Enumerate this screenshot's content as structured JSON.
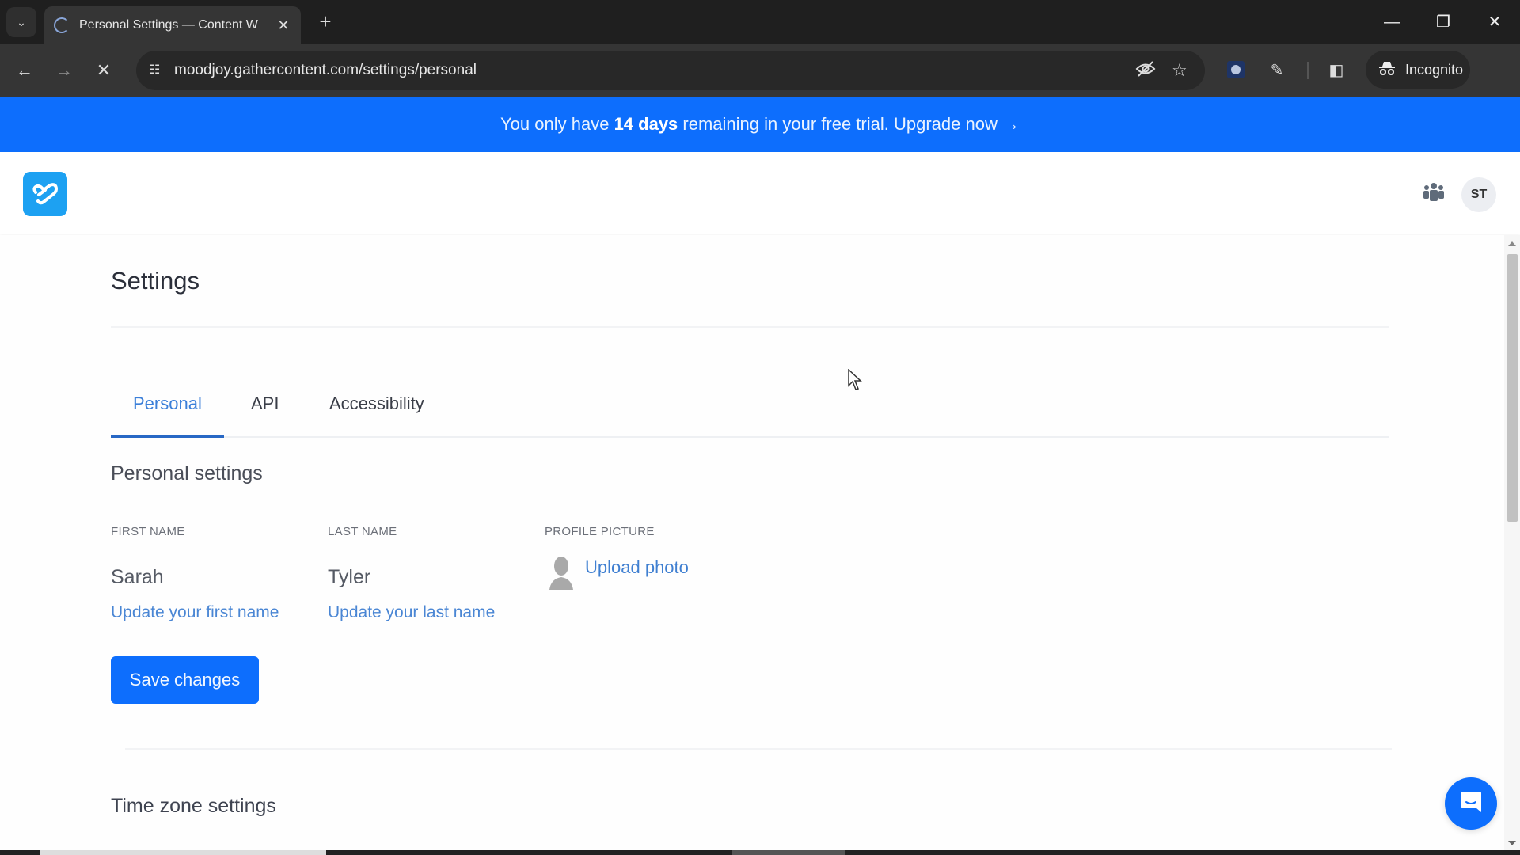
{
  "browser": {
    "tab_title": "Personal Settings — Content W",
    "url": "moodjoy.gathercontent.com/settings/personal",
    "incognito_label": "Incognito"
  },
  "banner": {
    "prefix": "You only have ",
    "highlight": "14 days",
    "suffix": " remaining in your free trial. ",
    "link": "Upgrade now →"
  },
  "header": {
    "avatar_initials": "ST"
  },
  "page": {
    "title": "Settings",
    "tabs": [
      {
        "label": "Personal",
        "active": true
      },
      {
        "label": "API",
        "active": false
      },
      {
        "label": "Accessibility",
        "active": false
      }
    ],
    "personal_section_title": "Personal settings",
    "fields": {
      "first_name": {
        "label": "FIRST NAME",
        "value": "Sarah",
        "link": "Update your first name"
      },
      "last_name": {
        "label": "LAST NAME",
        "value": "Tyler",
        "link": "Update your last name"
      },
      "profile_picture": {
        "label": "PROFILE PICTURE",
        "link": "Upload photo"
      }
    },
    "save_label": "Save changes",
    "timezone_section_title": "Time zone settings"
  },
  "colors": {
    "accent": "#0d6efd",
    "link": "#4a86d4",
    "logo": "#1da1f2"
  }
}
